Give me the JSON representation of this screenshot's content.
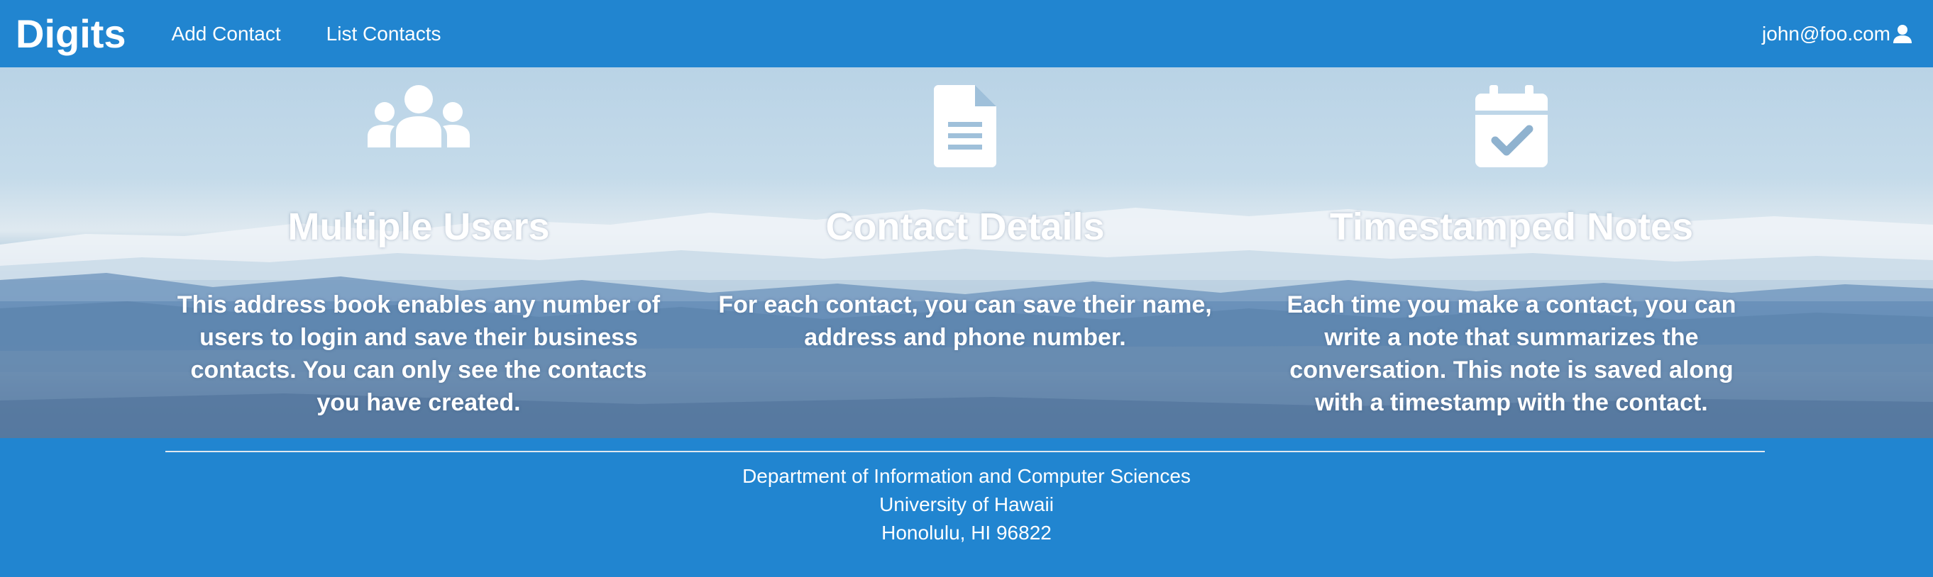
{
  "navbar": {
    "brand": "Digits",
    "links": [
      {
        "label": "Add Contact"
      },
      {
        "label": "List Contacts"
      }
    ],
    "user": {
      "email": "john@foo.com",
      "icon": "user-icon"
    }
  },
  "hero": {
    "features": [
      {
        "icon": "users-icon",
        "title": "Multiple Users",
        "text": "This address book enables any number of users to login and save their business contacts. You can only see the contacts you have created."
      },
      {
        "icon": "file-text-icon",
        "title": "Contact Details",
        "text": "For each contact, you can save their name, address and phone number."
      },
      {
        "icon": "calendar-check-icon",
        "title": "Timestamped Notes",
        "text": "Each time you make a contact, you can write a note that summarizes the conversation. This note is saved along with a timestamp with the contact."
      }
    ]
  },
  "footer": {
    "lines": [
      "Department of Information and Computer Sciences",
      "University of Hawaii",
      "Honolulu, HI 96822"
    ]
  },
  "colors": {
    "primary": "#2185D0",
    "text": "#FFFFFF"
  }
}
